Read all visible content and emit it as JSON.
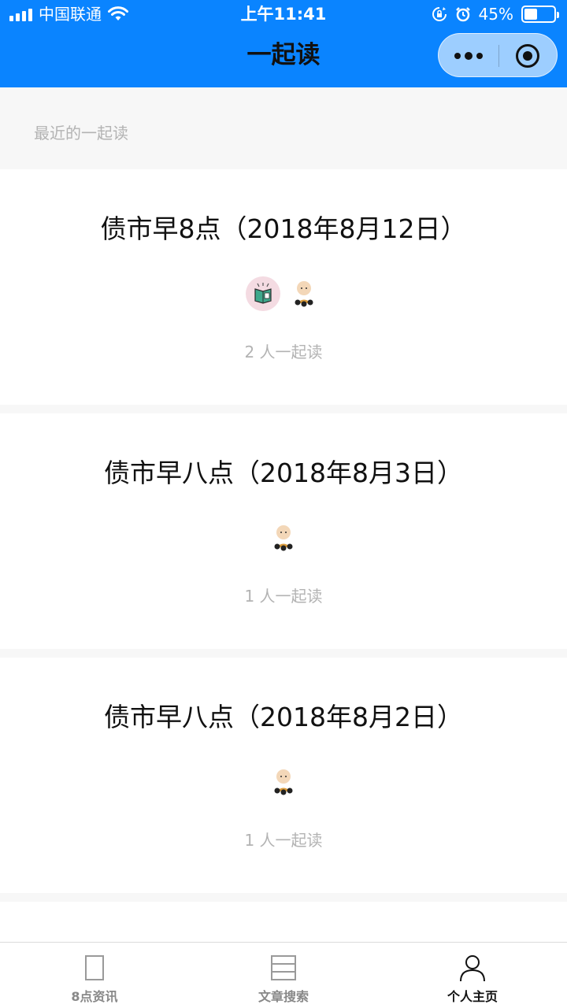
{
  "status_bar": {
    "carrier": "中国联通",
    "time": "上午11:41",
    "battery_percent": "45%",
    "battery_level": 0.45
  },
  "nav": {
    "title": "一起读",
    "more_icon": "more-dots-icon",
    "close_icon": "target-close-icon"
  },
  "section": {
    "header": "最近的一起读"
  },
  "cards": [
    {
      "title": "债市早8点（2018年8月12日）",
      "avatars": [
        "book-avatar",
        "monk-avatar"
      ],
      "readers": "2 人一起读"
    },
    {
      "title": "债市早八点（2018年8月3日）",
      "avatars": [
        "monk-avatar"
      ],
      "readers": "1 人一起读"
    },
    {
      "title": "债市早八点（2018年8月2日）",
      "avatars": [
        "monk-avatar"
      ],
      "readers": "1 人一起读"
    }
  ],
  "tabbar": {
    "tabs": [
      {
        "label": "8点资讯",
        "icon": "page-icon",
        "active": false
      },
      {
        "label": "文章搜索",
        "icon": "list-document-icon",
        "active": false
      },
      {
        "label": "个人主页",
        "icon": "person-icon",
        "active": true
      }
    ]
  },
  "colors": {
    "nav_blue": "#0a84ff",
    "muted_text": "#b3b3b3",
    "page_background": "#f7f7f7"
  }
}
